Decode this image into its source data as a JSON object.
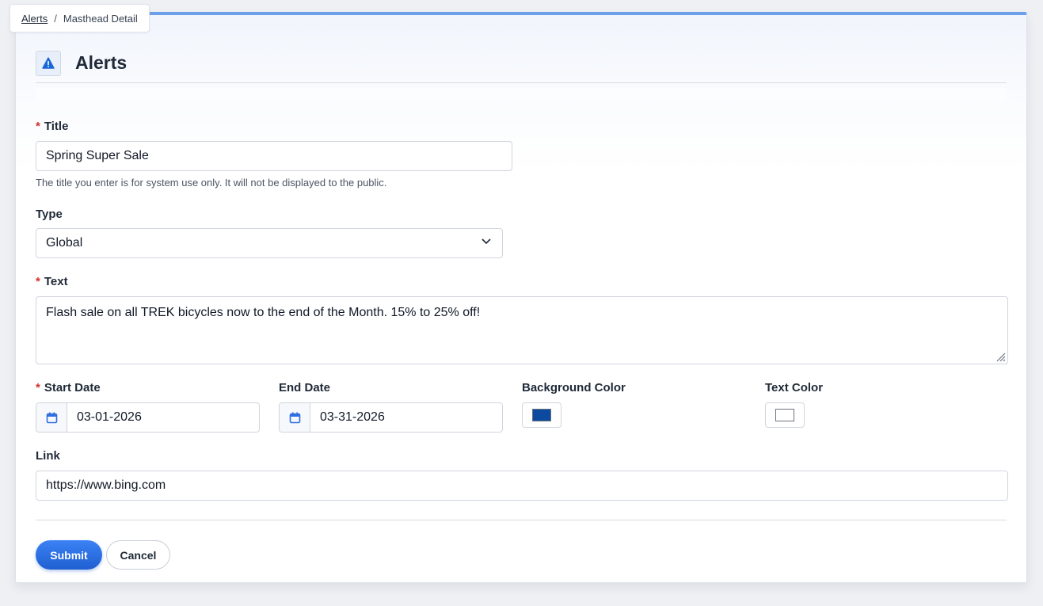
{
  "breadcrumb": {
    "root": "Alerts",
    "separator": "/",
    "current": "Masthead Detail"
  },
  "header": {
    "title": "Alerts",
    "icon": "warning-triangle-icon"
  },
  "form": {
    "title": {
      "label": "Title",
      "required": "*",
      "value": "Spring Super Sale",
      "help": "The title you enter is for system use only. It will not be displayed to the public."
    },
    "type": {
      "label": "Type",
      "value": "Global"
    },
    "text": {
      "label": "Text",
      "required": "*",
      "value": "Flash sale on all TREK bicycles now to the end of the Month. 15% to 25% off!"
    },
    "start_date": {
      "label": "Start Date",
      "required": "*",
      "value": "03-01-2026"
    },
    "end_date": {
      "label": "End Date",
      "value": "03-31-2026"
    },
    "background_color": {
      "label": "Background Color",
      "value": "#0b4a9e"
    },
    "text_color": {
      "label": "Text Color",
      "value": "#ffffff"
    },
    "link": {
      "label": "Link",
      "value": "https://www.bing.com"
    }
  },
  "actions": {
    "submit": "Submit",
    "cancel": "Cancel"
  },
  "colors": {
    "accent": "#2f6fe0",
    "required": "#d32f2f",
    "top_border": "#6c9eea"
  }
}
